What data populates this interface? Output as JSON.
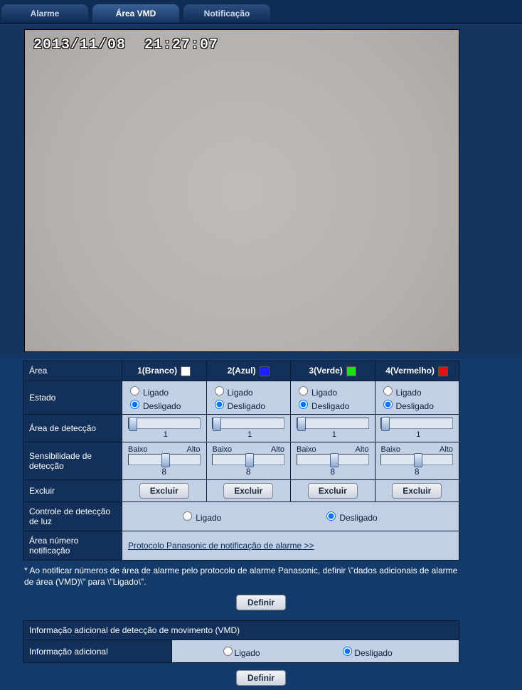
{
  "tabs": {
    "alarm": {
      "label": "Alarme",
      "active": false
    },
    "vmd": {
      "label": "Área VMD",
      "active": true
    },
    "notify": {
      "label": "Notificação",
      "active": false
    }
  },
  "osd_text": "2013/11/08  21:27:07",
  "labels": {
    "area": "Área",
    "estado": "Estado",
    "area_det": "Área de detecção",
    "sens": "Sensibilidade de detecção",
    "excluir": "Excluir",
    "light_ctrl": "Controle de detecção de luz",
    "area_num_not": "Área número notificação",
    "baixo": "Baixo",
    "alto": "Alto"
  },
  "on_off": {
    "on": "Ligado",
    "off": "Desligado"
  },
  "columns": [
    {
      "id": "c1",
      "name": "1(Branco)",
      "swatch": "#ffffff",
      "state": "off",
      "det": 1,
      "sens": 8
    },
    {
      "id": "c2",
      "name": "2(Azul)",
      "swatch": "#1a23ff",
      "state": "off",
      "det": 1,
      "sens": 8
    },
    {
      "id": "c3",
      "name": "3(Verde)",
      "swatch": "#1adf1a",
      "state": "off",
      "det": 1,
      "sens": 8
    },
    {
      "id": "c4",
      "name": "4(Vermelho)",
      "swatch": "#e21212",
      "state": "off",
      "det": 1,
      "sens": 8
    }
  ],
  "light_ctrl_value": "off",
  "link_text": "Protocolo Panasonic de notificação de alarme >>",
  "note_text": "* Ao notificar números de área de alarme pelo protocolo de alarme Panasonic, definir \\\"dados adicionais de alarme de área (VMD)\\\" para \\\"Ligado\\\".",
  "buttons": {
    "excluir": "Excluir",
    "definir": "Definir"
  },
  "add_info": {
    "title": "Informação adicional de detecção de movimento (VMD)",
    "label": "Informação adicional",
    "value": "off"
  }
}
